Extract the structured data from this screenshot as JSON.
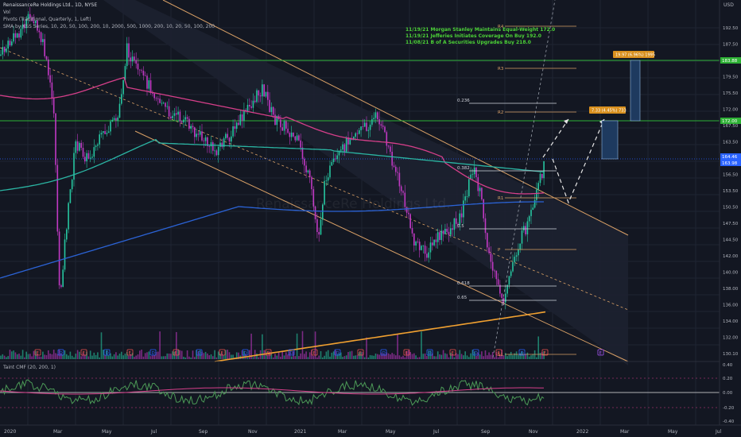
{
  "legend": {
    "title": "RenaissanceRe Holdings Ltd., 1D, NYSE",
    "vol": "Vol",
    "pivots": "Pivots (Traditional, Quarterly, 1, Left)",
    "sma": "SMA by KSS Series, 10, 20, 50, 100, 200, 10, 2000, 500, 1000, 200, 10, 20, 50, 100, 200"
  },
  "news": [
    "11/19/21 Morgan Stanley Maintains Equal-Weight 172.0",
    "11/19/21 Jefferies Initiates Coverage On Buy 192.0",
    "11/08/21 B of A Securities Upgrades Buy 218.0"
  ],
  "watermark": "RenaissanceRe Holdings Ltd.",
  "price_axis": {
    "currency": "USD",
    "ticks": [
      "192.50",
      "187.50",
      "183.50",
      "179.50",
      "175.50",
      "172.00",
      "167.50",
      "163.50",
      "159.50",
      "156.50",
      "153.50",
      "150.50",
      "147.50",
      "144.50",
      "142.00",
      "140.00",
      "138.00",
      "136.00",
      "134.00",
      "132.00",
      "130.10"
    ],
    "badges": [
      {
        "text": "183.88",
        "color": "#2eb135"
      },
      {
        "text": "172.00",
        "color": "#2eb135"
      },
      {
        "text": "164.46",
        "color": "#2962ff"
      },
      {
        "text": "163.98",
        "color": "#2962ff"
      }
    ]
  },
  "cmf_axis": {
    "ticks": [
      "0.40",
      "0.20",
      "0.00",
      "-0.20",
      "-0.40"
    ]
  },
  "time_axis": [
    "2020",
    "Mar",
    "May",
    "Jul",
    "Sep",
    "Nov",
    "2021",
    "Mar",
    "May",
    "Jul",
    "Sep",
    "Nov",
    "2022",
    "Mar",
    "May",
    "Jul"
  ],
  "fib_labels": [
    "0.236",
    "0.382",
    "0.5",
    "0.618",
    "0.65",
    "0"
  ],
  "pivot_labels": [
    "R4",
    "R3",
    "R2",
    "R1",
    "P",
    "S1"
  ],
  "target_labels": [
    "19.97 (6.96%) 1995",
    "7.33 (4.45%) 733"
  ],
  "cmf_title": "Taint CMF (20, 200, 1)",
  "event_markers": [
    "E",
    "D",
    "E",
    "D",
    "E",
    "D",
    "E",
    "D",
    "E",
    "D",
    "E",
    "D",
    "E",
    "D",
    "E",
    "D",
    "E",
    "D",
    "E",
    "D",
    "E",
    "D",
    "E"
  ],
  "future_event": "E",
  "colors": {
    "bg": "#131722",
    "up": "#26a69a",
    "down": "#ef5350",
    "candle_up": "#26c6a0",
    "candle_down": "#c139c4",
    "channel": "#d9a066",
    "sma_pink": "#d63f8a",
    "sma_teal": "#2bb5a3",
    "sma_blue": "#2b63d6",
    "sma_orange": "#f0a030",
    "green_line": "#2eb135",
    "cmf": "#4c9a57"
  }
}
